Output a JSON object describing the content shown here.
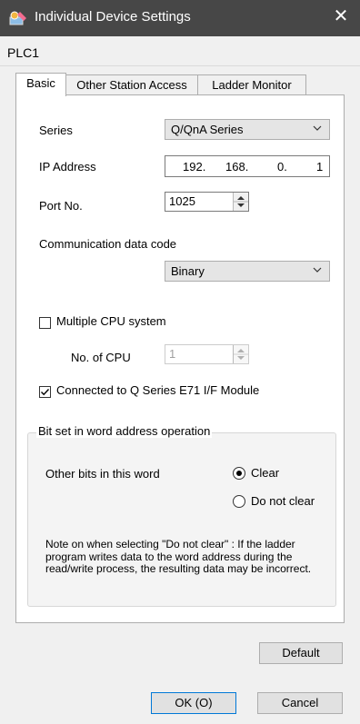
{
  "window": {
    "title": "Individual Device Settings",
    "close_glyph": "✕"
  },
  "device": {
    "name": "PLC1"
  },
  "tabs": [
    {
      "label": "Basic",
      "active": true
    },
    {
      "label": "Other Station Access",
      "active": false
    },
    {
      "label": "Ladder Monitor",
      "active": false
    }
  ],
  "form": {
    "series": {
      "label": "Series",
      "value": "Q/QnA Series"
    },
    "ip": {
      "label": "IP Address",
      "octets": [
        "192.",
        "168.",
        "0.",
        "1"
      ]
    },
    "port": {
      "label": "Port No.",
      "value": "1025"
    },
    "comm_code": {
      "label": "Communication data code",
      "value": "Binary"
    },
    "multiple_cpu": {
      "label": "Multiple CPU system",
      "checked": false
    },
    "cpu_count": {
      "label": "No. of CPU",
      "value": "1"
    },
    "e71": {
      "label": "Connected to Q Series E71 I/F Module",
      "checked": true
    }
  },
  "bit_group": {
    "title": "Bit set in word address operation",
    "other_bits_label": "Other bits in this word",
    "option_clear": "Clear",
    "option_do_not_clear": "Do not clear",
    "selected": "Clear",
    "note": "Note on when selecting \"Do not clear\" : If the ladder program writes data to the word address during the read/write process, the resulting data may be incorrect."
  },
  "buttons": {
    "default": "Default",
    "ok": "OK (O)",
    "cancel": "Cancel"
  },
  "icons": {
    "app": "app-settings-icon",
    "close": "close-icon",
    "chevron": "chevron-down-icon",
    "spin": "spin-up-down-icon",
    "check": "check-icon"
  },
  "colors": {
    "titlebar": "#474747",
    "panel": "#ffffff",
    "window": "#f0f0f0",
    "focus": "#0078d7"
  }
}
